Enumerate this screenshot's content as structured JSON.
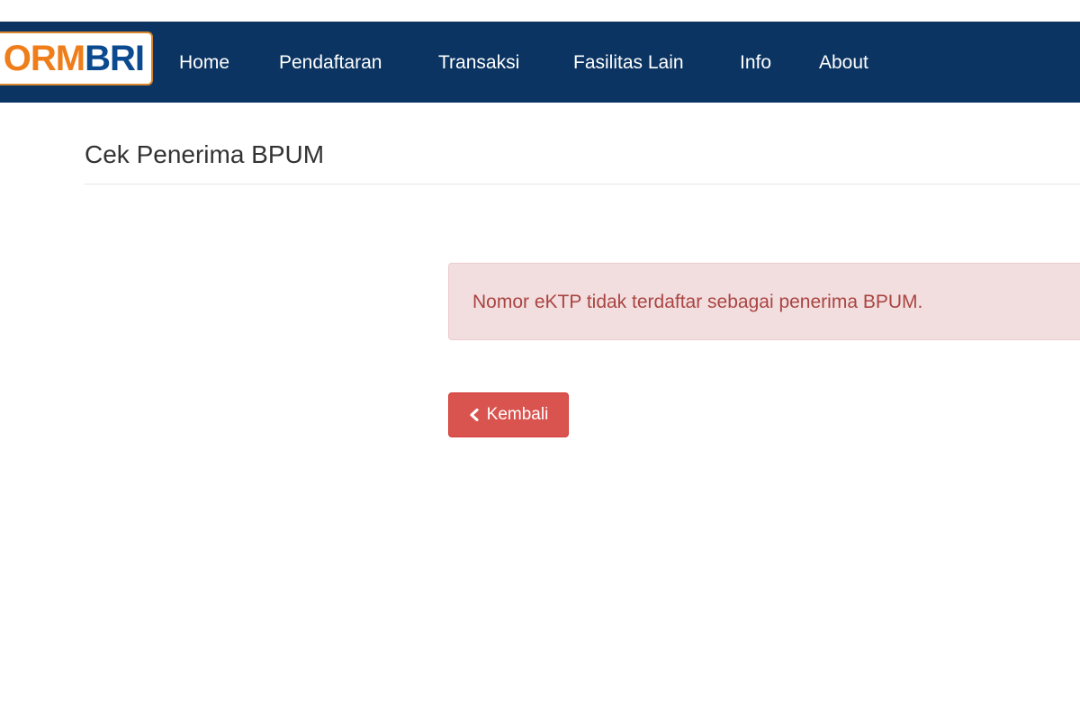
{
  "navbar": {
    "logo": {
      "part_a": "ORM",
      "part_b": "BRI"
    },
    "items": [
      "Home",
      "Pendaftaran",
      "Transaksi",
      "Fasilitas Lain",
      "Info",
      "About"
    ]
  },
  "page": {
    "title": "Cek Penerima BPUM"
  },
  "alert": {
    "message": "Nomor eKTP tidak terdaftar sebagai penerima BPUM."
  },
  "back_button": {
    "label": "Kembali",
    "icon": "chevron-left-icon"
  },
  "colors": {
    "navbar": "#0b3462",
    "alert_bg": "#f2dede",
    "alert_text": "#a94442",
    "button_danger": "#d9534f",
    "logo_orange": "#ef7d1a",
    "logo_blue": "#0b4a8f"
  }
}
